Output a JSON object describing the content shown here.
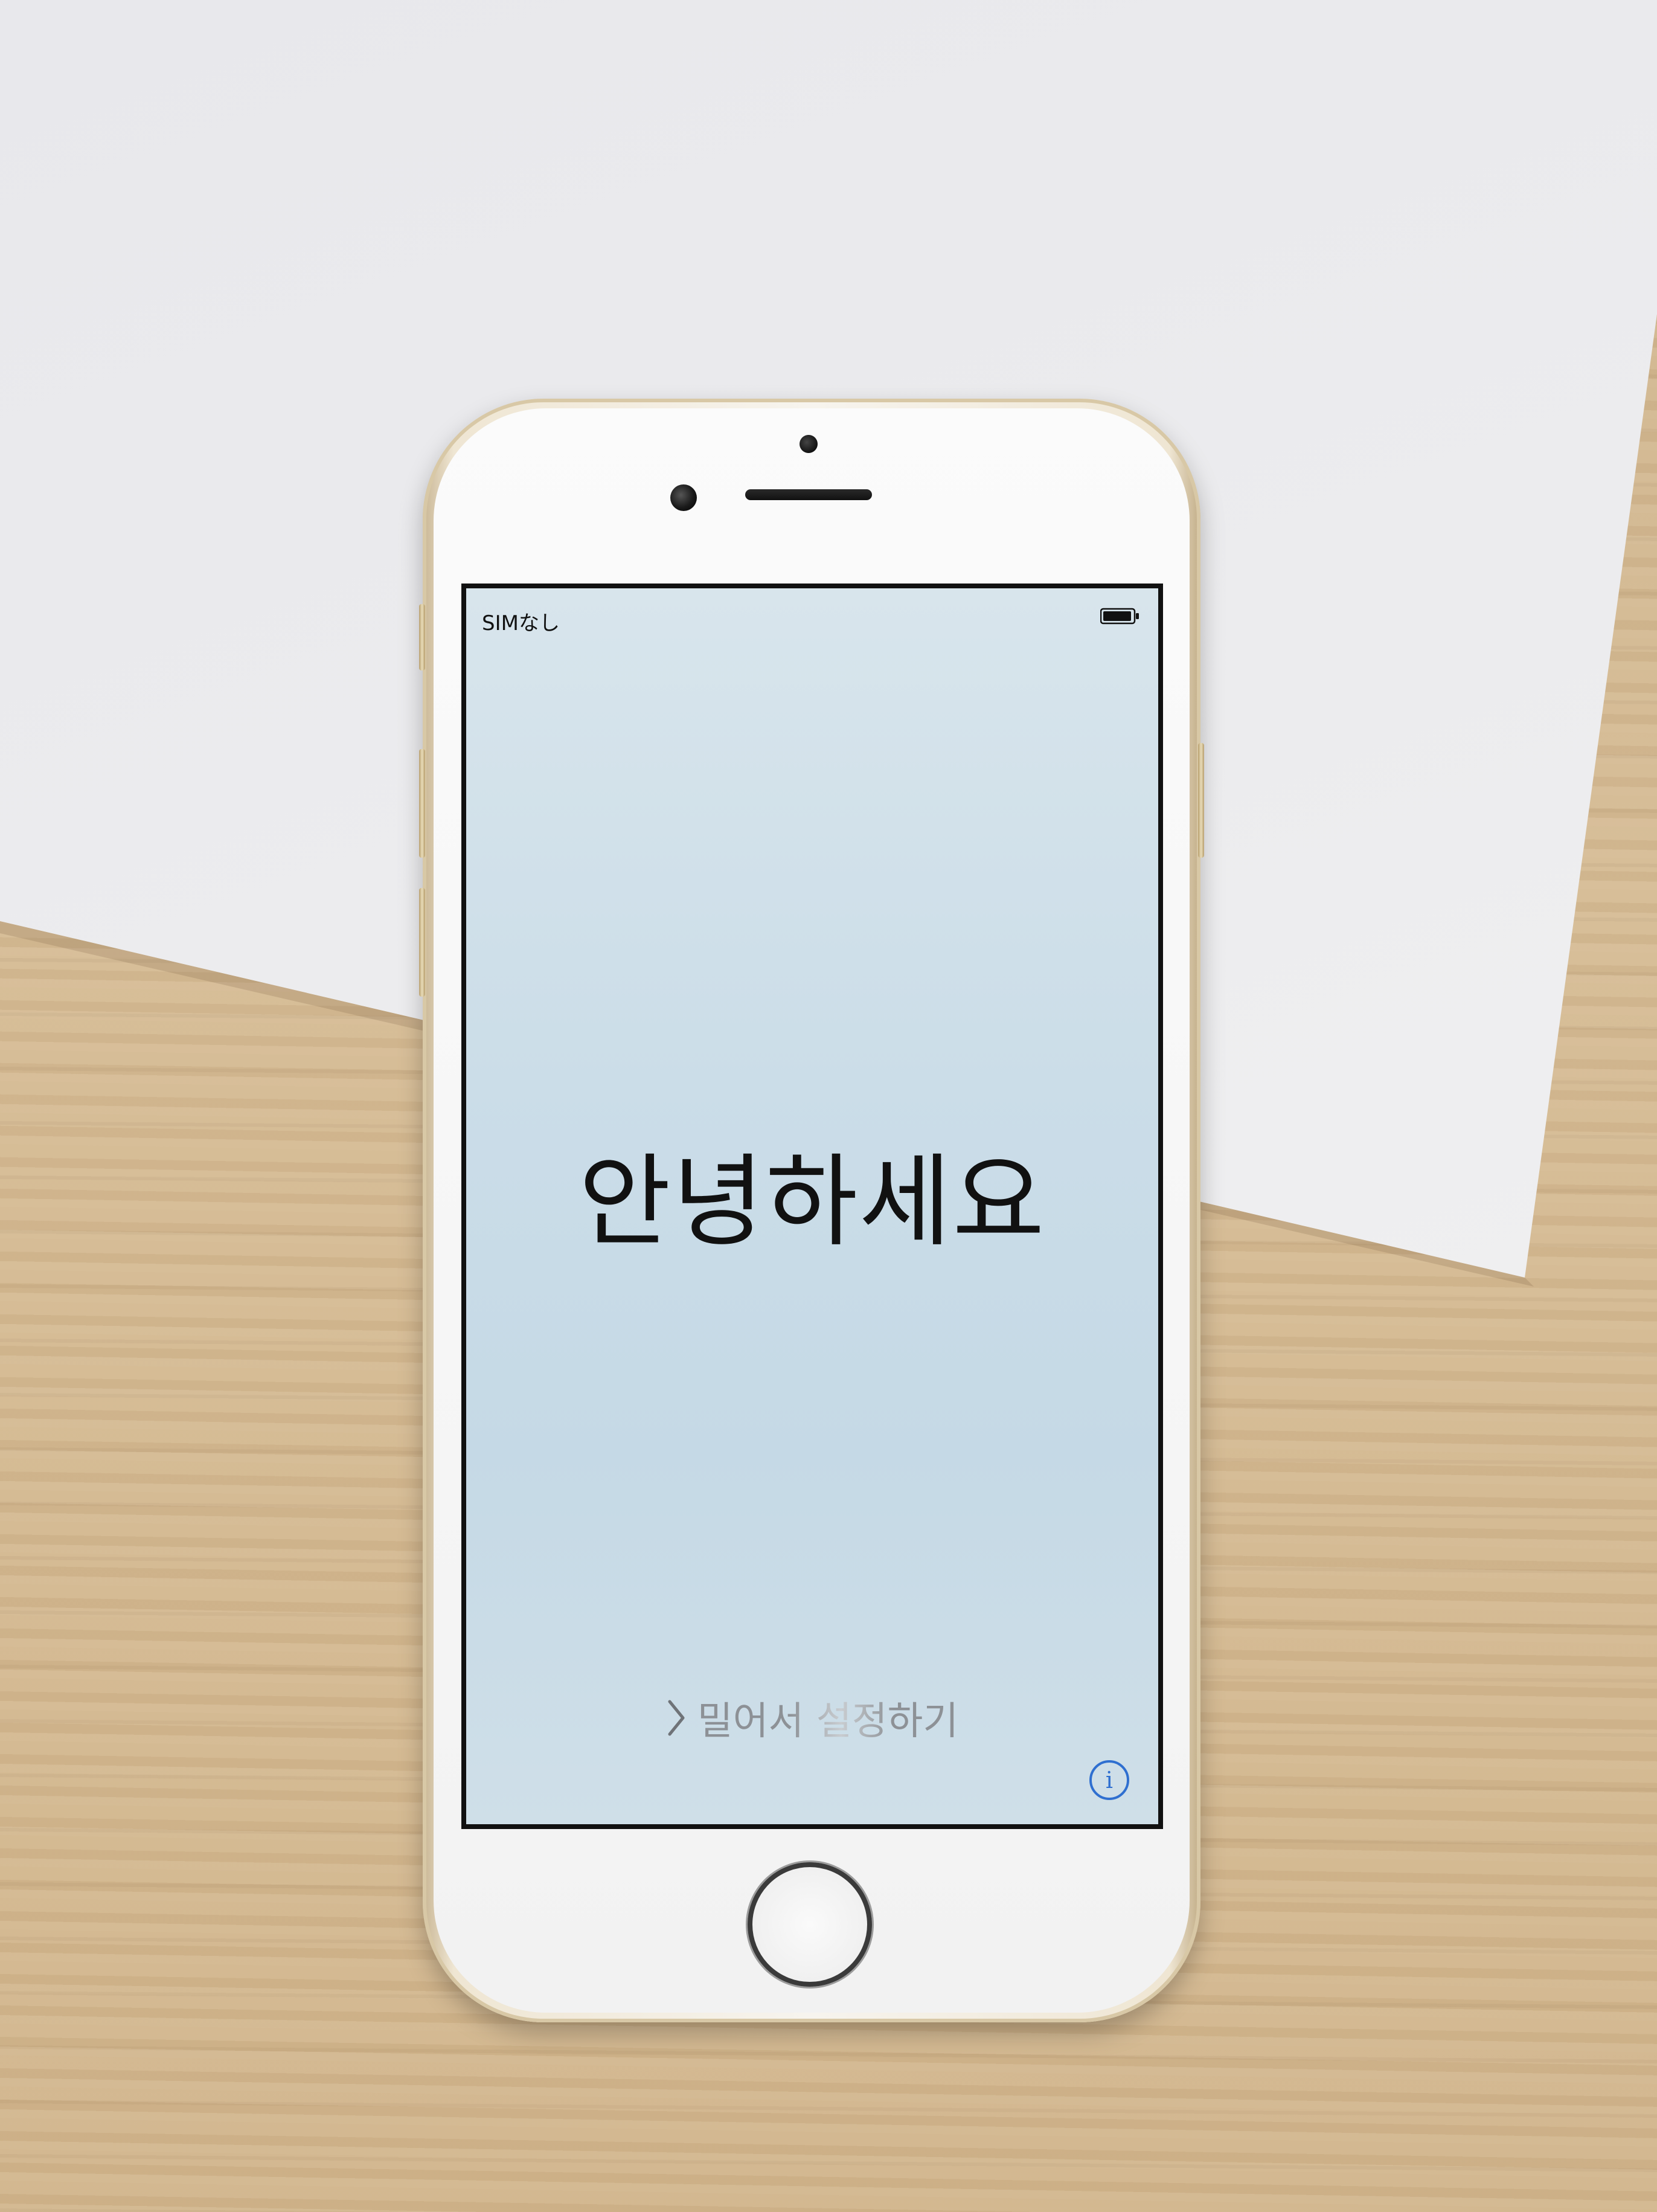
{
  "status_bar": {
    "carrier": "SIMなし",
    "battery_icon": "battery-icon"
  },
  "welcome": {
    "greeting": "안녕하세요",
    "slide_to_setup": "밀어서 설정하기",
    "slide_icon": "chevron-right-icon"
  },
  "info_button": {
    "icon": "info-icon",
    "glyph": "i"
  },
  "colors": {
    "accent": "#2f6fd0",
    "text": "#111111",
    "slide_text": "#9a9ea3",
    "screen_bg": "#cbdde8",
    "phone_gold": "#e9dcb9"
  }
}
